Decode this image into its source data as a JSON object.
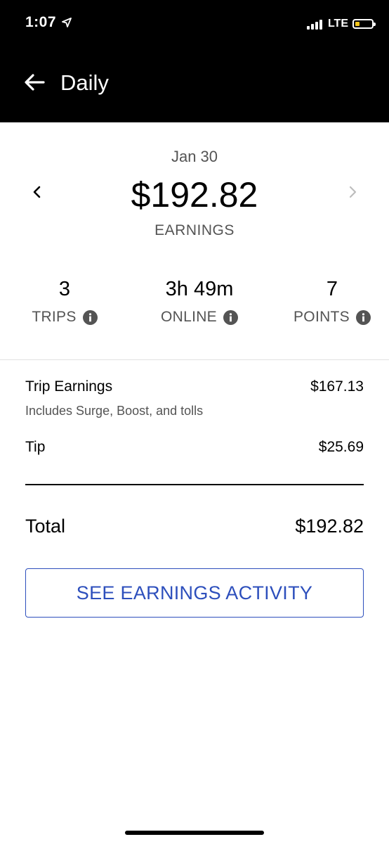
{
  "status_bar": {
    "time": "1:07",
    "network": "LTE",
    "battery_level": 0.25,
    "battery_color": "#f5c518"
  },
  "header": {
    "title": "Daily",
    "back_icon": "arrow-left-icon"
  },
  "summary": {
    "date": "Jan 30",
    "amount": "$192.82",
    "label": "EARNINGS",
    "prev_icon": "chevron-left-icon",
    "next_icon": "chevron-right-icon"
  },
  "stats": [
    {
      "value": "3",
      "label": "TRIPS"
    },
    {
      "value": "3h 49m",
      "label": "ONLINE"
    },
    {
      "value": "7",
      "label": "POINTS"
    }
  ],
  "breakdown": {
    "trip_earnings": {
      "label": "Trip Earnings",
      "value": "$167.13",
      "sub": "Includes Surge, Boost, and tolls"
    },
    "tip": {
      "label": "Tip",
      "value": "$25.69"
    },
    "total": {
      "label": "Total",
      "value": "$192.82"
    }
  },
  "cta": {
    "label": "SEE EARNINGS ACTIVITY"
  },
  "colors": {
    "accent": "#2d4fbc",
    "header_bg": "#000000",
    "muted_text": "#545454"
  }
}
